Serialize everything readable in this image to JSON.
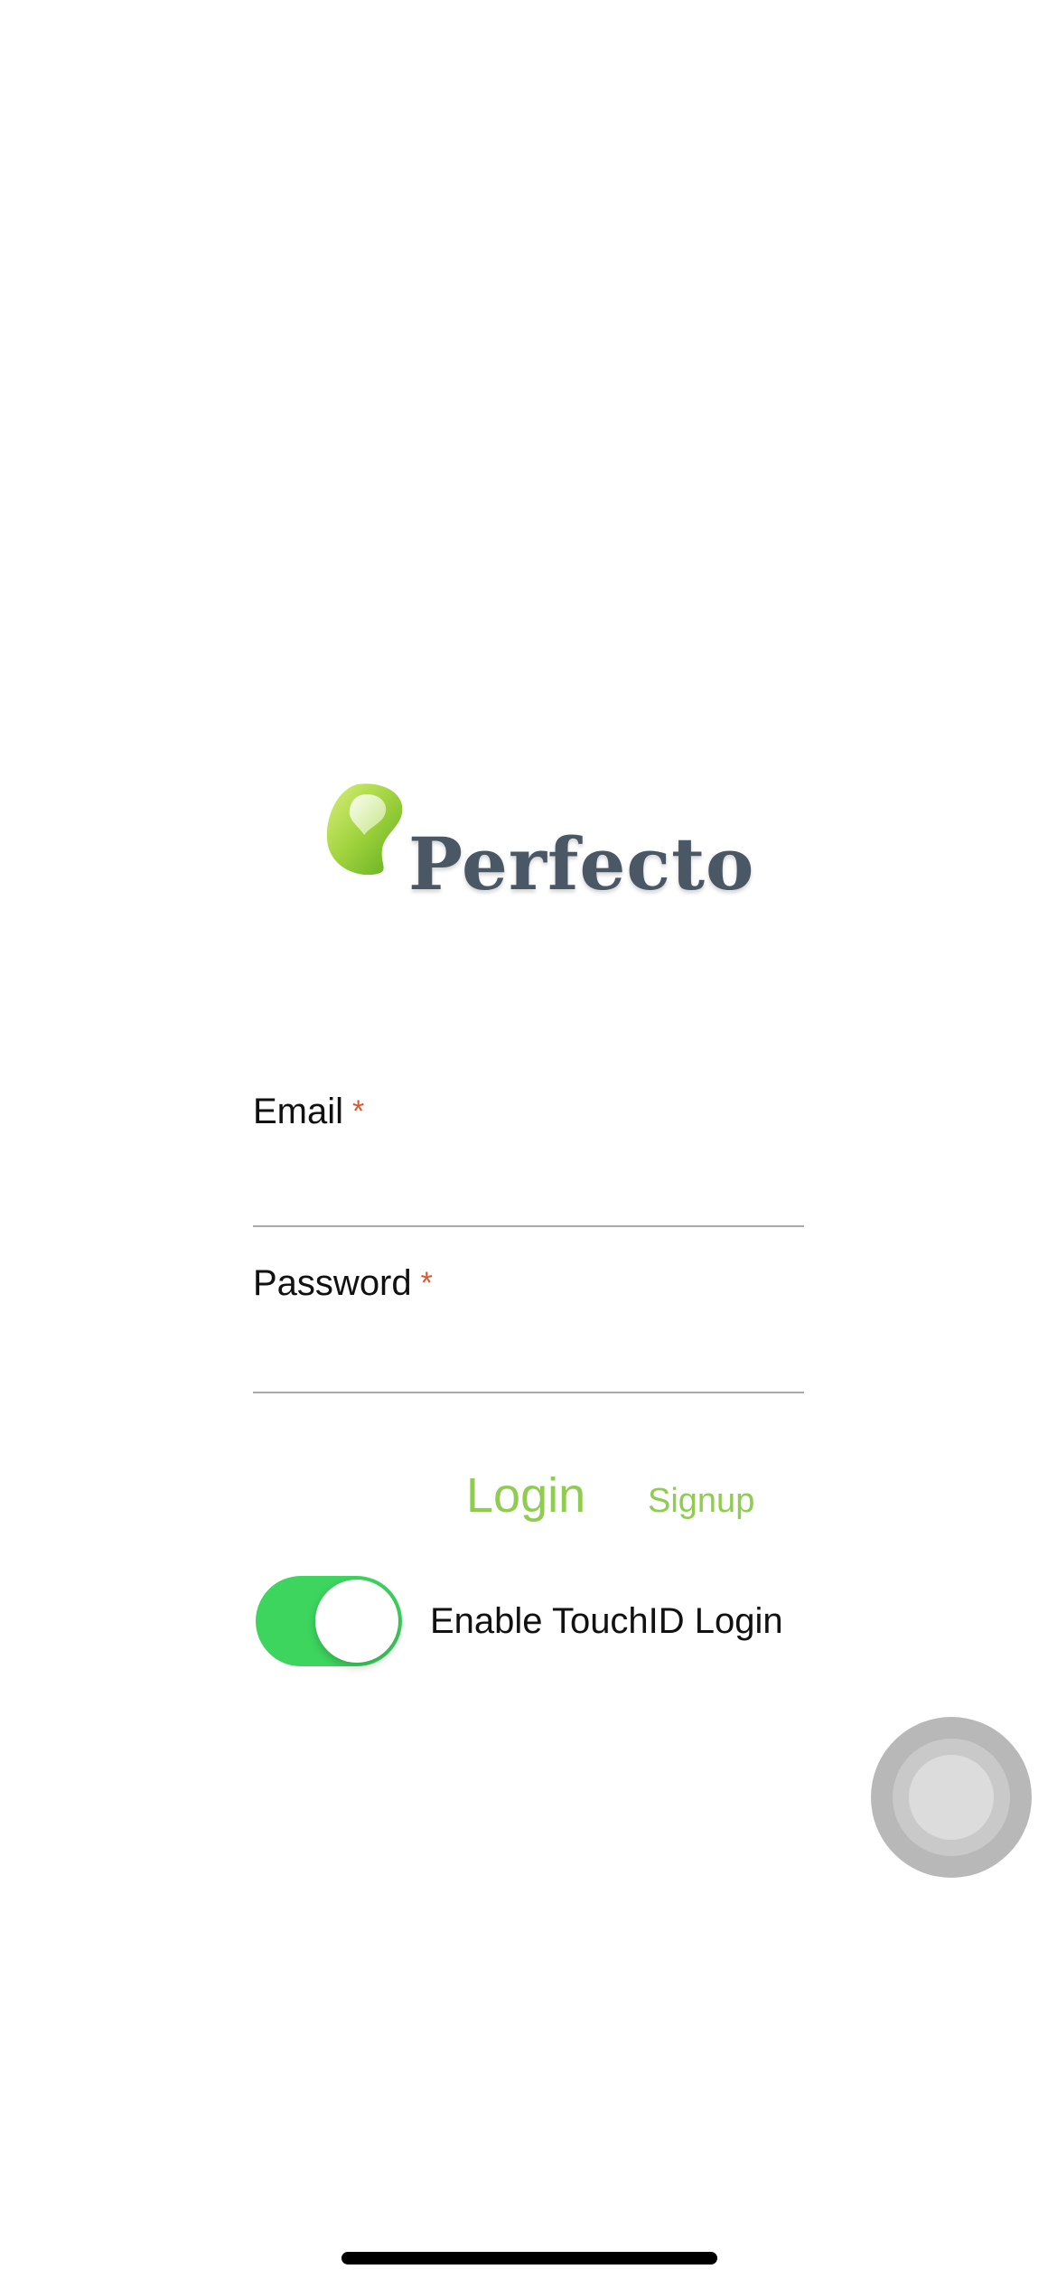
{
  "logo": {
    "name": "Perfecto"
  },
  "form": {
    "email": {
      "label": "Email",
      "required_marker": "*",
      "value": "",
      "placeholder": ""
    },
    "password": {
      "label": "Password",
      "required_marker": "*",
      "value": "",
      "placeholder": ""
    }
  },
  "actions": {
    "login_label": "Login",
    "signup_label": "Signup"
  },
  "touchid": {
    "label": "Enable TouchID Login",
    "enabled": true
  },
  "colors": {
    "accent_green": "#8fcc4f",
    "toggle_on": "#3ed55f",
    "required": "#e2542c",
    "logo_text": "#4a5866"
  }
}
